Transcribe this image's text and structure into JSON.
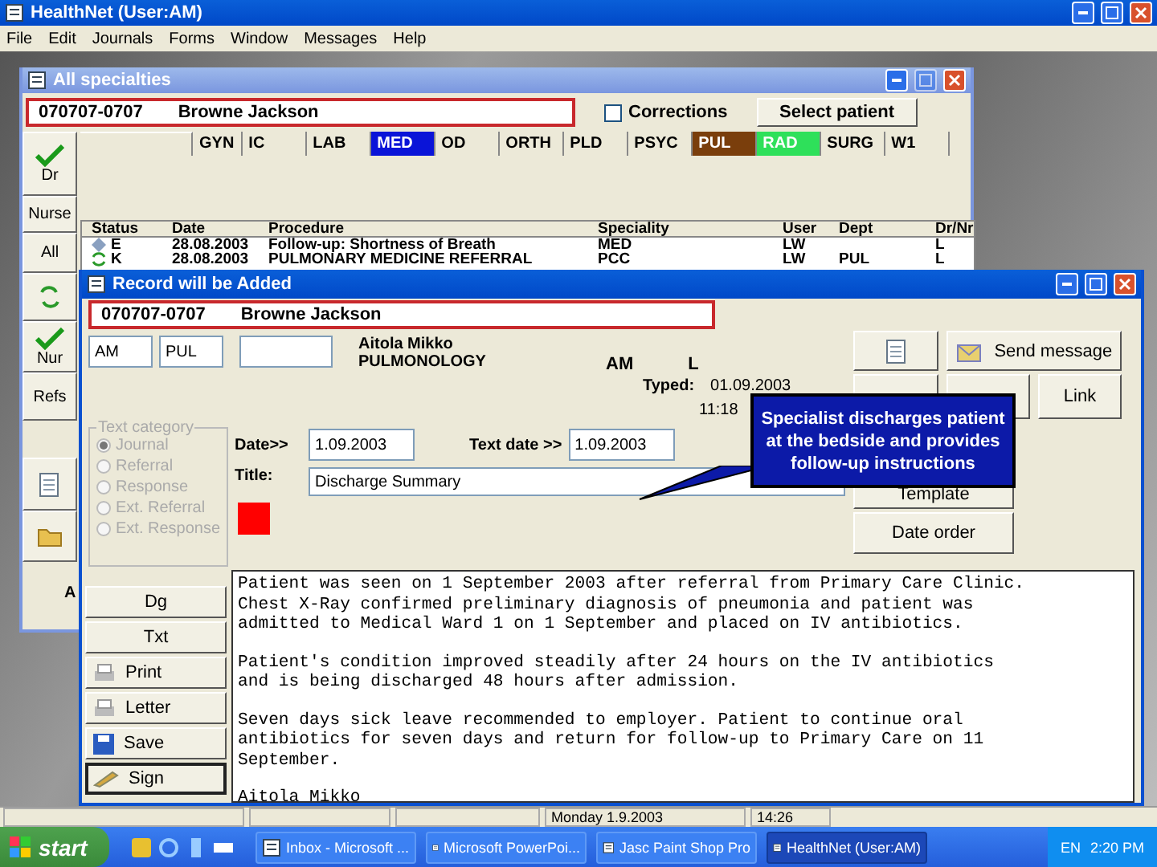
{
  "app_window": {
    "title": "HealthNet (User:AM)"
  },
  "menu": [
    "File",
    "Edit",
    "Journals",
    "Forms",
    "Window",
    "Messages",
    "Help"
  ],
  "specialties_window": {
    "title": "All specialties",
    "patient_id": "070707-0707",
    "patient_name": "Browne Jackson",
    "corrections": {
      "label": "Corrections",
      "checked": false
    },
    "select_patient": "Select patient",
    "side_buttons": [
      {
        "kind": "check",
        "label": "Dr"
      },
      {
        "kind": "text",
        "label": "Nurse"
      },
      {
        "kind": "text",
        "label": "All"
      },
      {
        "kind": "arrows"
      },
      {
        "kind": "check",
        "label": "Nur"
      },
      {
        "kind": "text",
        "label": "Refs"
      },
      {
        "kind": "page"
      },
      {
        "kind": "folder"
      }
    ],
    "side_label": "A",
    "tabs": [
      {
        "label": "GYN"
      },
      {
        "label": "IC"
      },
      {
        "label": "LAB"
      },
      {
        "label": "MED",
        "color": "#0a14d8"
      },
      {
        "label": "OD"
      },
      {
        "label": "ORTH"
      },
      {
        "label": "PLD"
      },
      {
        "label": "PSYC"
      },
      {
        "label": "PUL",
        "color": "#7a3e0c"
      },
      {
        "label": "RAD",
        "color": "#2ee05a"
      },
      {
        "label": "SURG"
      },
      {
        "label": "W1"
      }
    ],
    "table": {
      "columns": [
        "Status",
        "Date",
        "Procedure",
        "Speciality",
        "User",
        "Dept",
        "Dr/Nr"
      ],
      "rows": [
        {
          "kind": "diamond",
          "cells": [
            "E",
            "28.08.2003",
            "Follow-up: Shortness of Breath",
            "MED",
            "LW",
            "",
            "L"
          ]
        },
        {
          "kind": "arrows",
          "cells": [
            "K",
            "28.08.2003",
            "PULMONARY MEDICINE REFERRAL",
            "PCC",
            "LW",
            "PUL",
            "L"
          ]
        }
      ]
    }
  },
  "record_window": {
    "title": "Record will be Added",
    "patient_id": "070707-0707",
    "patient_name": "Browne Jackson",
    "user_code": "AM",
    "dept_code": "PUL",
    "doctor_name": "Aitola Mikko",
    "doctor_specialty": "PULMONOLOGY",
    "user": "AM",
    "dr_nr": "L",
    "typed_label": "Typed:",
    "typed_date": "01.09.2003",
    "typed_time": "11:18",
    "send_message": "Send message",
    "link": "Link",
    "template": "Template",
    "date_order": "Date order",
    "text_category": {
      "legend": "Text category",
      "options": [
        {
          "label": "Journal",
          "selected": true
        },
        {
          "label": "Referral",
          "selected": false
        },
        {
          "label": "Response",
          "selected": false
        },
        {
          "label": "Ext. Referral",
          "selected": false
        },
        {
          "label": "Ext. Response",
          "selected": false
        }
      ]
    },
    "date_label": "Date>>",
    "date": "1.09.2003",
    "text_date_label": "Text date >>",
    "text_date": "1.09.2003",
    "title_label": "Title:",
    "title_value": "Discharge Summary",
    "left_buttons": [
      {
        "kind": "text",
        "label": "Dg"
      },
      {
        "kind": "text",
        "label": "Txt"
      },
      {
        "kind": "printer",
        "label": "Print"
      },
      {
        "kind": "printer",
        "label": "Letter"
      },
      {
        "kind": "disk",
        "label": "Save"
      },
      {
        "kind": "pen",
        "label": "Sign"
      }
    ],
    "text": [
      "Patient was seen on 1 September 2003 after referral from Primary Care Clinic.\nChest X-Ray confirmed preliminary diagnosis of pneumonia and patient was\nadmitted to Medical Ward 1 on 1 September and placed on IV antibiotics.",
      "Patient's condition improved steadily after 24 hours on the IV antibiotics\nand is being discharged 48 hours after admission.",
      "Seven days sick leave recommended to employer. Patient to continue oral\nantibiotics for seven days and return for follow-up to Primary Care on 11\nSeptember.",
      "Aitola Mikko"
    ]
  },
  "callout": "Specialist discharges patient at the bedside and provides follow-up instructions",
  "status_bar": {
    "date": "Monday 1.9.2003",
    "time": "14:26"
  },
  "taskbar": {
    "start": "start",
    "tasks": [
      {
        "label": "Inbox - Microsoft ...",
        "selected": false
      },
      {
        "label": "Microsoft PowerPoi...",
        "selected": false
      },
      {
        "label": "Jasc Paint Shop Pro",
        "selected": false
      },
      {
        "label": "HealthNet (User:AM)",
        "selected": true
      }
    ],
    "language": "EN",
    "clock": "2:20 PM"
  }
}
